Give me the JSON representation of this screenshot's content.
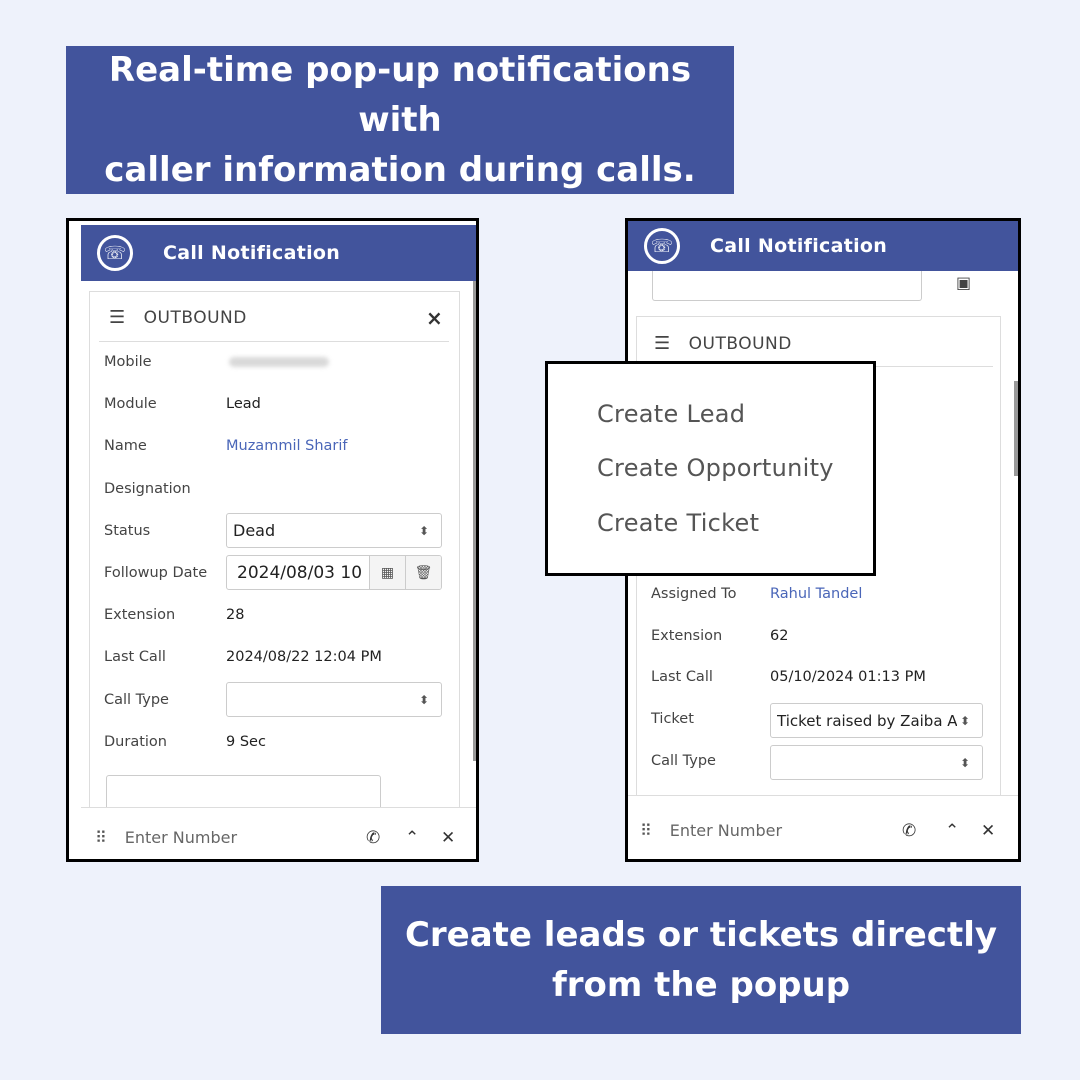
{
  "banners": {
    "top": [
      "Real-time pop-up notifications with",
      "caller information during calls."
    ],
    "bottom": [
      "Create leads or tickets directly",
      "from the popup"
    ]
  },
  "left": {
    "title": "Call Notification",
    "section": "OUTBOUND",
    "mobile_label": "Mobile",
    "module_label": "Module",
    "module_value": "Lead",
    "name_label": "Name",
    "name_value": "Muzammil Sharif",
    "designation_label": "Designation",
    "status_label": "Status",
    "status_value": "Dead",
    "followup_label": "Followup Date",
    "followup_value": "2024/08/03 10",
    "extension_label": "Extension",
    "extension_value": "28",
    "lastcall_label": "Last Call",
    "lastcall_value": "2024/08/22 12:04 PM",
    "calltype_label": "Call Type",
    "calltype_value": "",
    "duration_label": "Duration",
    "duration_value": "9 Sec",
    "footer_placeholder": "Enter Number"
  },
  "right": {
    "title": "Call Notification",
    "section": "OUTBOUND",
    "assigned_label": "Assigned To",
    "assigned_value": "Rahul Tandel",
    "extension_label": "Extension",
    "extension_value": "62",
    "lastcall_label": "Last Call",
    "lastcall_value": "05/10/2024 01:13 PM",
    "ticket_label": "Ticket",
    "ticket_value": "Ticket raised by Zaiba A",
    "calltype_label": "Call Type",
    "calltype_value": "",
    "footer_placeholder": "Enter Number"
  },
  "menu": {
    "items": [
      "Create Lead",
      "Create Opportunity",
      "Create Ticket"
    ]
  },
  "icons": {
    "logo": "phone-swirl-icon",
    "menu": "hamburger-icon",
    "close": "close-icon",
    "calendar": "calendar-icon",
    "trash": "trash-icon",
    "phone": "phone-icon",
    "chevron": "chevron-up-icon",
    "grip": "grip-icon",
    "save": "save-icon"
  },
  "colors": {
    "brand": "#42549c",
    "link": "#4a66b8",
    "background": "#eef2fb"
  }
}
